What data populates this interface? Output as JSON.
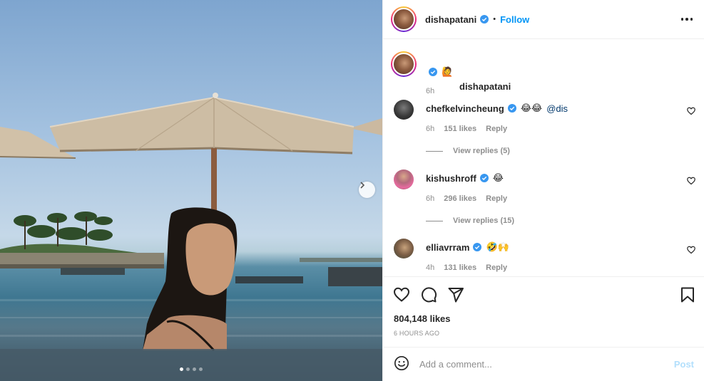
{
  "post": {
    "author": "dishapatani",
    "follow_label": "Follow",
    "separator": "•",
    "image_alt": "",
    "carousel_dots": 4,
    "active_dot": 0
  },
  "caption": {
    "username": "dishapatani",
    "emoji": "🙋",
    "time": "6h"
  },
  "comments": [
    {
      "username": "chefkelvincheung",
      "emojis": "😂😂",
      "mention": "@dis",
      "time": "6h",
      "likes": "151 likes",
      "reply": "Reply",
      "view_replies": "View replies (5)"
    },
    {
      "username": "kishushroff",
      "emojis": "😂",
      "time": "6h",
      "likes": "296 likes",
      "reply": "Reply",
      "view_replies": "View replies (15)"
    },
    {
      "username": "elliavrram",
      "emojis": "🤣🙌",
      "time": "4h",
      "likes": "131 likes",
      "reply": "Reply"
    }
  ],
  "actions": {
    "likes": "804,148 likes",
    "posted": "6 HOURS AGO"
  },
  "composer": {
    "placeholder": "Add a comment...",
    "post_label": "Post"
  },
  "colors": {
    "accent": "#0095f6",
    "verified": "#3897f0",
    "post_disabled": "#b2dffc",
    "muted": "#8e8e8e"
  },
  "icons": [
    "chevron-right-icon",
    "verified-icon",
    "more-icon",
    "heart-icon",
    "comment-icon",
    "share-icon",
    "bookmark-icon",
    "emoji-icon"
  ]
}
